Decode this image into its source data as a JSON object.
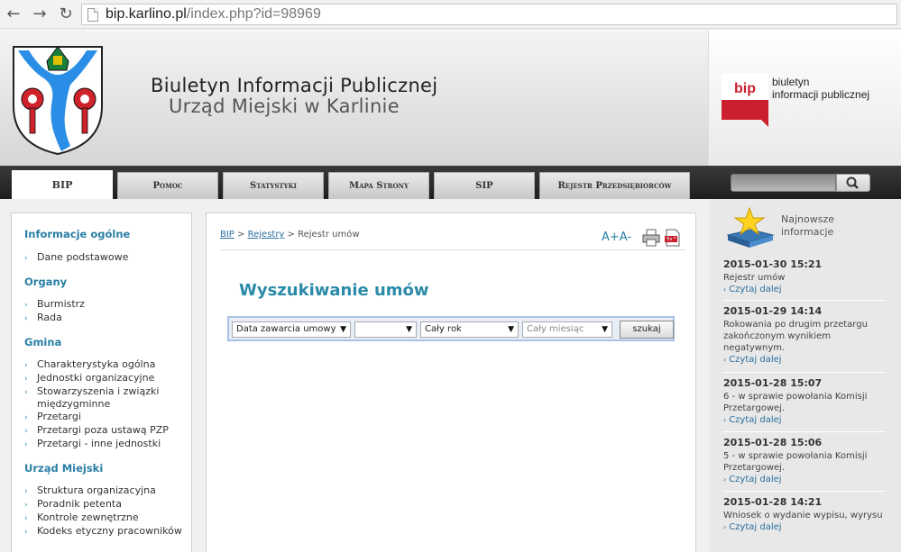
{
  "browser": {
    "url_host": "bip.karlino.pl",
    "url_path": "/index.php?id=98969"
  },
  "header": {
    "title": "Biuletyn Informacji Publicznej",
    "subtitle": "Urząd Miejski w Karlinie",
    "bip_logo_mark": "bip",
    "bip_logo_line1": "biuletyn",
    "bip_logo_line2": "informacji publicznej"
  },
  "nav": {
    "tabs": [
      {
        "label": "BIP",
        "active": true
      },
      {
        "label": "Pomoc"
      },
      {
        "label": "Statystyki"
      },
      {
        "label": "Mapa Strony"
      },
      {
        "label": "SIP"
      },
      {
        "label": "Rejestr Przedsiębiorców"
      }
    ]
  },
  "sidebar": {
    "sections": [
      {
        "title": "Informacje ogólne",
        "items": [
          "Dane podstawowe"
        ]
      },
      {
        "title": "Organy",
        "items": [
          "Burmistrz",
          "Rada"
        ]
      },
      {
        "title": "Gmina",
        "items": [
          "Charakterystyka ogólna",
          "Jednostki organizacyjne",
          "Stowarzyszenia i związki międzygminne",
          "Przetargi",
          "Przetargi poza ustawą PZP",
          "Przetargi - inne jednostki"
        ]
      },
      {
        "title": "Urząd Miejski",
        "items": [
          "Struktura organizacyjna",
          "Poradnik petenta",
          "Kontrole zewnętrzne",
          "Kodeks etyczny pracowników"
        ]
      }
    ]
  },
  "main": {
    "breadcrumb": [
      "BIP",
      "Rejestry",
      "Rejestr umów"
    ],
    "breadcrumb_sep": ">",
    "font_size_label": "A+A-",
    "heading": "Wyszukiwanie umów",
    "filters": {
      "field": "Data zawarcia umowy",
      "year": "",
      "range": "Cały rok",
      "month": "Cały miesiąc",
      "submit": "szukaj"
    }
  },
  "news": {
    "header_line1": "Najnowsze",
    "header_line2": "informacje",
    "more_label": "Czytaj dalej",
    "items": [
      {
        "date": "2015-01-30 15:21",
        "text": "Rejestr umów"
      },
      {
        "date": "2015-01-29 14:14",
        "text": "Rokowania po drugim przetargu zakończonym wynikiem negatywnym."
      },
      {
        "date": "2015-01-28 15:07",
        "text": "6 - w sprawie powołania Komisji Przetargowej."
      },
      {
        "date": "2015-01-28 15:06",
        "text": "5 - w sprawie powołania Komisji Przetargowej."
      },
      {
        "date": "2015-01-28 14:21",
        "text": "Wniosek o wydanie wypisu, wyrysu"
      }
    ]
  },
  "colors": {
    "accent": "#2a7fa5",
    "bip_red": "#cc1f2e",
    "nav_dark": "#1e1e1e"
  }
}
